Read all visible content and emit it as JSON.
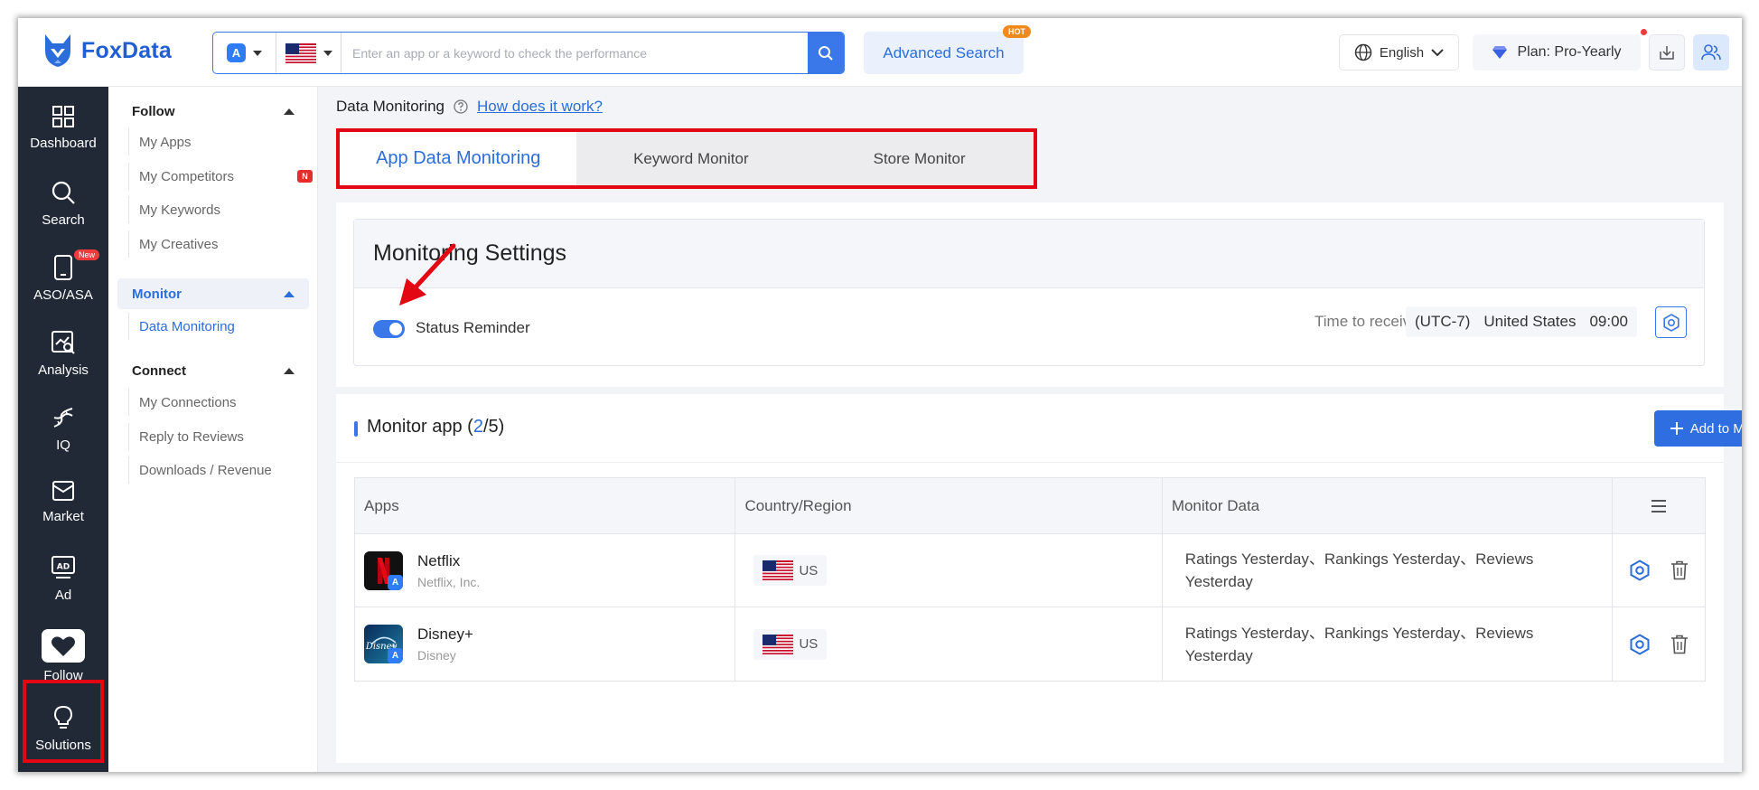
{
  "header": {
    "brand": "FoxData",
    "search_placeholder": "Enter an app or a keyword to check the performance",
    "advanced_search": "Advanced Search",
    "hot_badge": "HOT",
    "language": "English",
    "plan": "Plan: Pro-Yearly"
  },
  "leftnav": {
    "items": [
      {
        "label": "Dashboard",
        "icon": "dashboard-icon"
      },
      {
        "label": "Search",
        "icon": "search-icon"
      },
      {
        "label": "ASO/ASA",
        "icon": "phone-icon",
        "badge": "New"
      },
      {
        "label": "Analysis",
        "icon": "analysis-icon"
      },
      {
        "label": "IQ",
        "icon": "dna-icon"
      },
      {
        "label": "Market",
        "icon": "mail-icon"
      },
      {
        "label": "Ad",
        "icon": "ad-icon"
      },
      {
        "label": "Follow",
        "icon": "heart-icon"
      },
      {
        "label": "Solutions",
        "icon": "lightbulb-icon"
      }
    ]
  },
  "subnav": {
    "follow": {
      "title": "Follow",
      "items": [
        "My Apps",
        "My Competitors",
        "My Keywords",
        "My Creatives"
      ],
      "badge": "N"
    },
    "monitor": {
      "title": "Monitor",
      "items": [
        "Data Monitoring"
      ]
    },
    "connect": {
      "title": "Connect",
      "items": [
        "My Connections",
        "Reply to Reviews",
        "Downloads / Revenue"
      ]
    }
  },
  "main": {
    "breadcrumb": "Data Monitoring",
    "help_link": "How does it work?",
    "tabs": [
      "App Data Monitoring",
      "Keyword Monitor",
      "Store Monitor"
    ],
    "settings": {
      "title": "Monitoring Settings",
      "toggle_label": "Status Reminder",
      "toggle_on": true,
      "time_label": "Time to receive:",
      "timezone": "(UTC-7)",
      "country": "United States",
      "time": "09:00"
    },
    "apps": {
      "title_prefix": "Monitor app (",
      "count": "2",
      "title_sep": "/",
      "max": "5",
      "title_suffix": ")",
      "add_button": "Add to Monitor",
      "columns": [
        "Apps",
        "Country/Region",
        "Monitor Data"
      ],
      "rows": [
        {
          "name": "Netflix",
          "developer": "Netflix, Inc.",
          "country": "US",
          "monitor": "Ratings Yesterday、Rankings Yesterday、Reviews Yesterday"
        },
        {
          "name": "Disney+",
          "developer": "Disney",
          "country": "US",
          "monitor": "Ratings Yesterday、Rankings Yesterday、Reviews Yesterday"
        }
      ]
    }
  },
  "colors": {
    "accent": "#3a78ea",
    "nav_bg": "#212937",
    "highlight": "#e30613"
  }
}
